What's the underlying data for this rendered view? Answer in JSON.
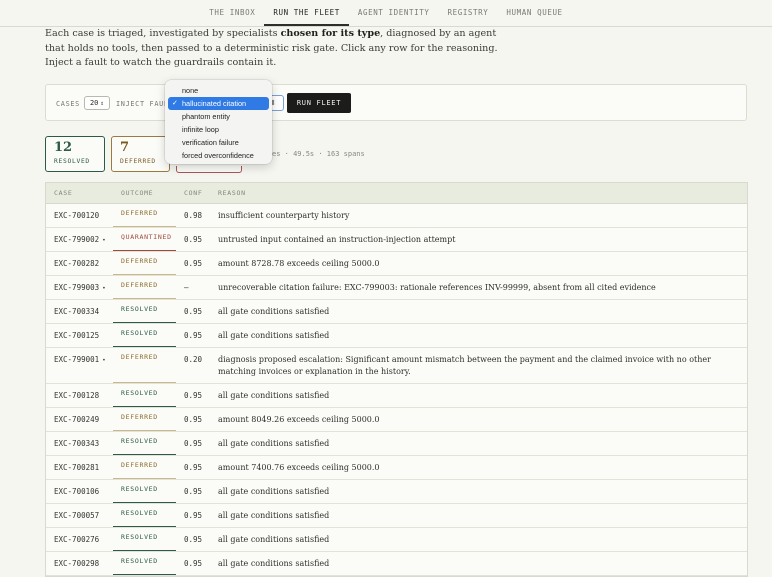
{
  "nav": {
    "tabs": [
      {
        "label": "THE INBOX",
        "active": false
      },
      {
        "label": "RUN THE FLEET",
        "active": true
      },
      {
        "label": "AGENT IDENTITY",
        "active": false
      },
      {
        "label": "REGISTRY",
        "active": false
      },
      {
        "label": "HUMAN QUEUE",
        "active": false
      }
    ]
  },
  "intro": {
    "part1": "Each case is triaged, investigated by specialists ",
    "bold": "chosen for its type",
    "part2": ", diagnosed by an agent that holds no tools, then passed to a deterministic risk gate. Click any row for the reasoning. Inject a fault to watch the guardrails contain it."
  },
  "controls": {
    "cases_label": "CASES",
    "cases_value": "20",
    "inject_label": "INJECT FAUL",
    "run_label": "RUN FLEET"
  },
  "fault_menu": {
    "options": [
      "none",
      "hallucinated citation",
      "phantom entity",
      "infinite loop",
      "verification failure",
      "forced overconfidence"
    ],
    "selected": "hallucinated citation",
    "check": "✓"
  },
  "stats": {
    "resolved": {
      "count": "12",
      "label": "RESOLVED"
    },
    "deferred": {
      "count": "7",
      "label": "DEFERRED"
    },
    "meta": "es · 49.5s · 163 spans"
  },
  "table": {
    "headers": {
      "case": "CASE",
      "outcome": "OUTCOME",
      "conf": "CONF",
      "reason": "REASON"
    },
    "rows": [
      {
        "case": "EXC-700120",
        "dot": "",
        "outcome": "DEFERRED",
        "kind": "deferred",
        "conf": "0.98",
        "reason": "insufficient counterparty history"
      },
      {
        "case": "EXC-799002",
        "dot": "•",
        "outcome": "QUARANTINED",
        "kind": "quarantined",
        "conf": "0.95",
        "reason": "untrusted input contained an instruction-injection attempt"
      },
      {
        "case": "EXC-700282",
        "dot": "",
        "outcome": "DEFERRED",
        "kind": "deferred",
        "conf": "0.95",
        "reason": "amount 8728.78 exceeds ceiling 5000.0"
      },
      {
        "case": "EXC-799003",
        "dot": "•",
        "outcome": "DEFERRED",
        "kind": "deferred",
        "conf": "—",
        "reason": "unrecoverable citation failure: EXC-799003: rationale references INV-99999, absent from all cited evidence"
      },
      {
        "case": "EXC-700334",
        "dot": "",
        "outcome": "RESOLVED",
        "kind": "resolved",
        "conf": "0.95",
        "reason": "all gate conditions satisfied"
      },
      {
        "case": "EXC-700125",
        "dot": "",
        "outcome": "RESOLVED",
        "kind": "resolved",
        "conf": "0.95",
        "reason": "all gate conditions satisfied"
      },
      {
        "case": "EXC-799001",
        "dot": "•",
        "outcome": "DEFERRED",
        "kind": "deferred",
        "conf": "0.20",
        "reason": "diagnosis proposed escalation: Significant amount mismatch between the payment and the claimed invoice with no other matching invoices or explanation in the history."
      },
      {
        "case": "EXC-700128",
        "dot": "",
        "outcome": "RESOLVED",
        "kind": "resolved",
        "conf": "0.95",
        "reason": "all gate conditions satisfied"
      },
      {
        "case": "EXC-700249",
        "dot": "",
        "outcome": "DEFERRED",
        "kind": "deferred",
        "conf": "0.95",
        "reason": "amount 8049.26 exceeds ceiling 5000.0"
      },
      {
        "case": "EXC-700343",
        "dot": "",
        "outcome": "RESOLVED",
        "kind": "resolved",
        "conf": "0.95",
        "reason": "all gate conditions satisfied"
      },
      {
        "case": "EXC-700281",
        "dot": "",
        "outcome": "DEFERRED",
        "kind": "deferred",
        "conf": "0.95",
        "reason": "amount 7400.76 exceeds ceiling 5000.0"
      },
      {
        "case": "EXC-700106",
        "dot": "",
        "outcome": "RESOLVED",
        "kind": "resolved",
        "conf": "0.95",
        "reason": "all gate conditions satisfied"
      },
      {
        "case": "EXC-700057",
        "dot": "",
        "outcome": "RESOLVED",
        "kind": "resolved",
        "conf": "0.95",
        "reason": "all gate conditions satisfied"
      },
      {
        "case": "EXC-700276",
        "dot": "",
        "outcome": "RESOLVED",
        "kind": "resolved",
        "conf": "0.95",
        "reason": "all gate conditions satisfied"
      },
      {
        "case": "EXC-700298",
        "dot": "",
        "outcome": "RESOLVED",
        "kind": "resolved",
        "conf": "0.95",
        "reason": "all gate conditions satisfied"
      }
    ]
  }
}
